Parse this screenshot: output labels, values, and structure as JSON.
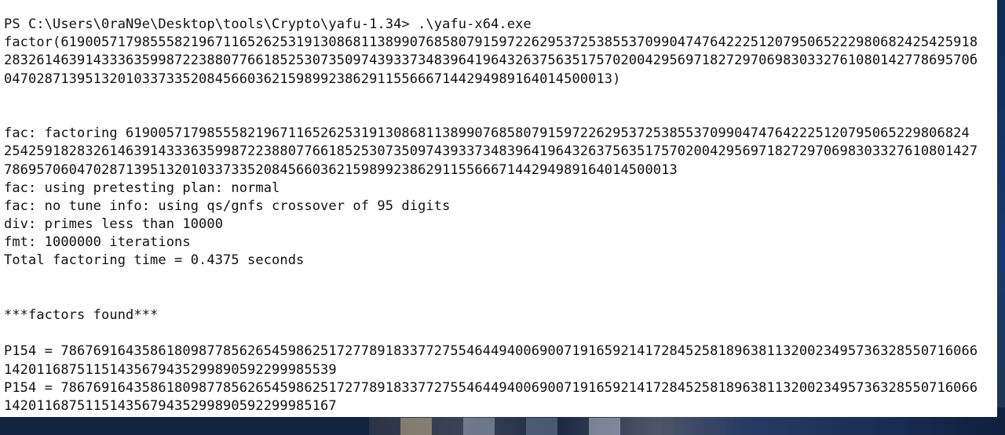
{
  "console": {
    "prompt_line": "PS C:\\Users\\0raN9e\\Desktop\\tools\\Crypto\\yafu-1.34> .\\yafu-x64.exe",
    "input_lines": [
      "factor(61900571798555821967116526253191308681138990768580791597226295372538553709904747642225120795065222980682425425918",
      "28326146391433363599872238807766185253073509743933734839641964326375635175702004295697182729706983033276108014277869570б",
      "04702871395132010337335208456603621598992386291155666714429498916401450001З)"
    ],
    "output_lines": [
      "fac: factoring 6190057179855582196711652625319130868113899076858079159722629537253855370990474764222512079506522980682​4",
      "25425918283261463914333635998722388077661852530735097439337348396419643263756351757020042956971827297069830332761080142​7",
      "78695706047028713951320103373352084566036215989923862911556667144294989164014500013",
      "fac: using pretesting plan: normal",
      "fac: no tune info: using qs/gnfs crossover of 95 digits",
      "div: primes less than 10000",
      "fmt: 1000000 iterations",
      "Total factoring time = 0.4375 seconds"
    ],
    "factors_header": "***factors found***",
    "factor_lines": [
      "P154 = 78676916435861809877856265459862517277891833772755464494006900719165921417284525818963811320023495736328550716066",
      "1420116875115143567943529989059229998553​9",
      "P154 = 78676916435861809877856265459862517277891833772755464494006900719165921417284525818963811320023495736328550716066",
      "14201168751151435679435299890592299985167"
    ]
  }
}
